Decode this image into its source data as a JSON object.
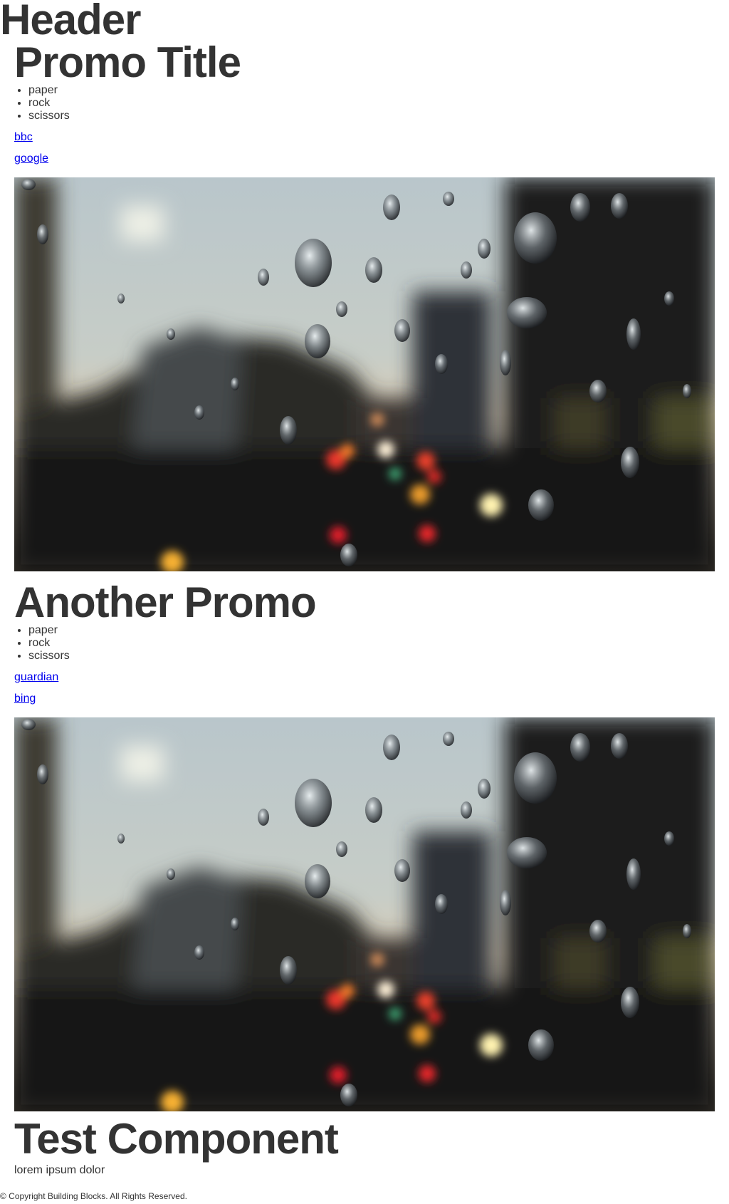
{
  "header": {
    "title": "Header"
  },
  "promos": [
    {
      "title": "Promo Title",
      "list": [
        "paper",
        "rock",
        "scissors"
      ],
      "links": [
        "bbc",
        "google"
      ],
      "image": "rainy-window-city-street-photo"
    },
    {
      "title": "Another Promo",
      "list": [
        "paper",
        "rock",
        "scissors"
      ],
      "links": [
        "guardian",
        "bing"
      ],
      "image": "rainy-window-city-street-photo"
    }
  ],
  "test_component": {
    "title": "Test Component",
    "text": "lorem ipsum dolor"
  },
  "footer": {
    "text": "© Copyright Building Blocks. All Rights Reserved."
  },
  "colors": {
    "text": "#333333",
    "link": "#0000ee",
    "background": "#ffffff"
  }
}
